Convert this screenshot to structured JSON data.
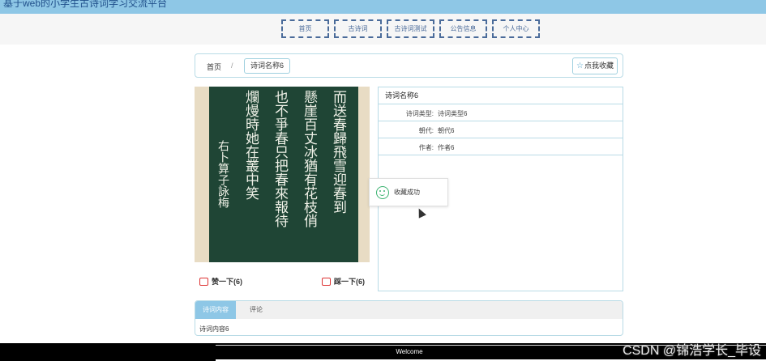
{
  "site": {
    "title": "基于web的小学生古诗词学习交流平台"
  },
  "nav": [
    {
      "label": "首页"
    },
    {
      "label": "古诗词"
    },
    {
      "label": "古诗词测试"
    },
    {
      "label": "公告信息"
    },
    {
      "label": "个人中心"
    }
  ],
  "breadcrumb": {
    "home": "首页",
    "separator": "/",
    "current": "诗词名称6"
  },
  "favorite_button": {
    "label": "点我收藏"
  },
  "image": {
    "columns": [
      "而送春歸飛雪迎春到",
      "懸崖百丈冰猶有花枝俏",
      "也不爭春只把春來報待",
      "爛熳時她在叢中笑",
      "右卜算子詠梅"
    ]
  },
  "votes": {
    "up_label": "赞一下(6)",
    "down_label": "踩一下(6)"
  },
  "detail": {
    "title": "诗词名称6",
    "rows": [
      {
        "key": "诗词类型:",
        "value": "诗词类型6"
      },
      {
        "key": "朝代:",
        "value": "朝代6"
      },
      {
        "key": "作者:",
        "value": "作者6"
      }
    ]
  },
  "toast": {
    "message": "收藏成功"
  },
  "tabs": {
    "items": [
      {
        "label": "诗词内容"
      },
      {
        "label": "评论"
      }
    ],
    "content": "诗词内容6"
  },
  "footer": {
    "text": "Welcome"
  },
  "watermark": {
    "text": "CSDN @锦浩学长_毕设"
  },
  "colors": {
    "accent": "#8ec7e6",
    "border": "#b9dbe6",
    "nav_border": "#4a6b9a"
  }
}
